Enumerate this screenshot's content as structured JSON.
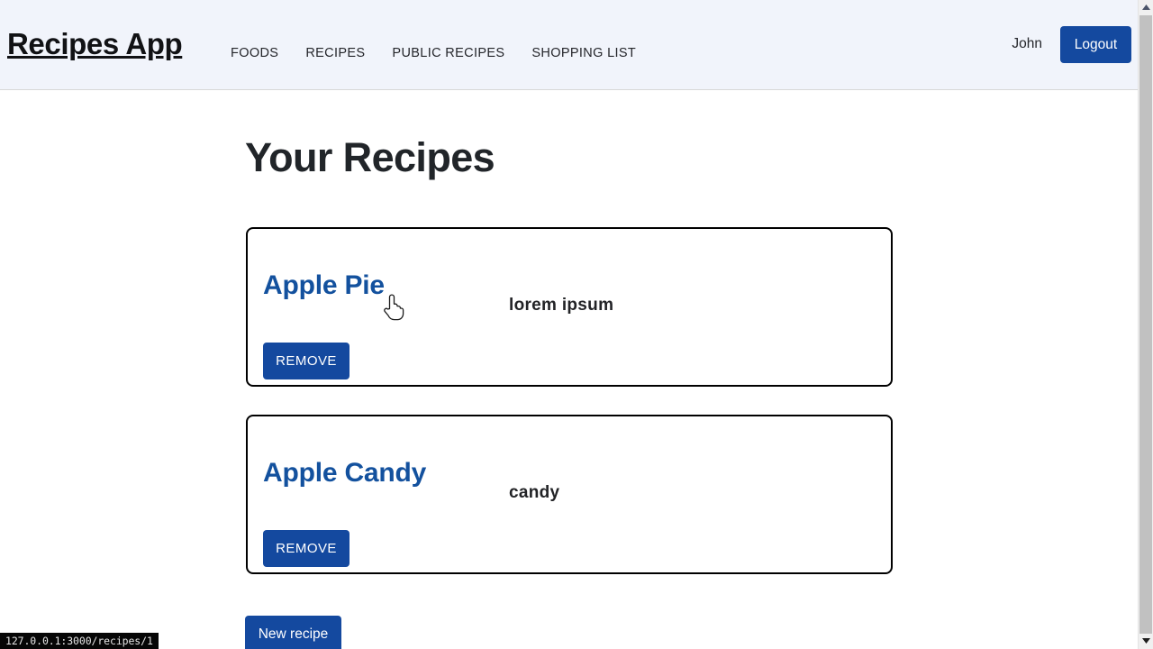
{
  "window": {
    "status_bar_text": "127.0.0.1:3000/recipes/1"
  },
  "navbar": {
    "brand": "Recipes App",
    "links": [
      {
        "label": "FOODS"
      },
      {
        "label": "RECIPES"
      },
      {
        "label": "PUBLIC RECIPES"
      },
      {
        "label": "SHOPPING LIST"
      }
    ],
    "user_name": "John",
    "logout_label": "Logout"
  },
  "main": {
    "page_title": "Your Recipes",
    "new_recipe_label": "New recipe",
    "recipes": [
      {
        "title": "Apple Pie",
        "description": "lorem ipsum",
        "remove_label": "REMOVE"
      },
      {
        "title": "Apple Candy",
        "description": "candy",
        "remove_label": "REMOVE"
      }
    ]
  },
  "colors": {
    "navbar_bg": "#f1f4fb",
    "primary_blue": "#14499f",
    "link_blue": "#13519e",
    "card_border": "#000000",
    "text_dark": "#212529",
    "status_bg": "#060606"
  },
  "scrollbar": {
    "up_icon": "triangle-up-icon",
    "down_icon": "triangle-down-icon"
  },
  "cursor": {
    "type": "pointer-hand-cursor"
  }
}
